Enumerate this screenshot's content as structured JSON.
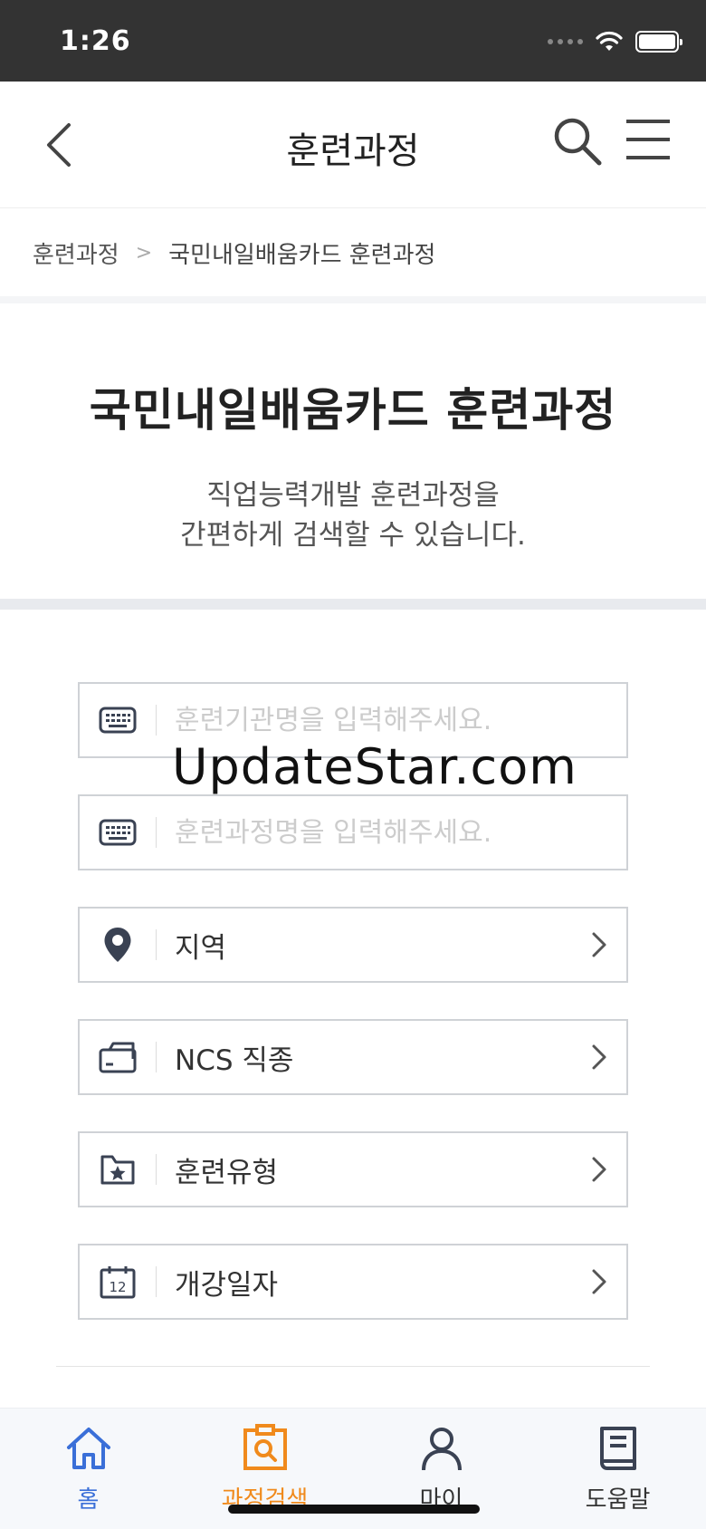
{
  "status": {
    "time": "1:26"
  },
  "nav": {
    "title": "훈련과정"
  },
  "breadcrumb": {
    "root": "훈련과정",
    "current": "국민내일배움카드 훈련과정"
  },
  "hero": {
    "title": "국민내일배움카드 훈련과정",
    "desc_line1": "직업능력개발 훈련과정을",
    "desc_line2": "간편하게 검색할 수 있습니다."
  },
  "form": {
    "institution_placeholder": "훈련기관명을 입력해주세요.",
    "course_placeholder": "훈련과정명을 입력해주세요.",
    "region_label": "지역",
    "ncs_label": "NCS 직종",
    "type_label": "훈련유형",
    "date_label": "개강일자"
  },
  "watermark": "UpdateStar.com",
  "tabs": [
    {
      "label": "홈",
      "icon": "home-icon",
      "color": "#3a6fd8"
    },
    {
      "label": "과정검색",
      "icon": "course-search-icon",
      "color": "#f08a1c"
    },
    {
      "label": "마이",
      "icon": "person-icon",
      "color": "#333333"
    },
    {
      "label": "도움말",
      "icon": "book-icon",
      "color": "#333333"
    }
  ]
}
